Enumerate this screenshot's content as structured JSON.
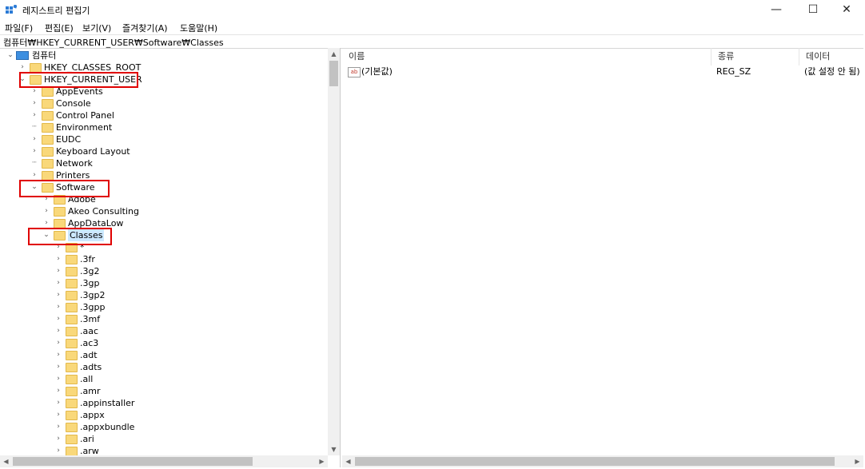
{
  "window": {
    "title": "레지스트리 편집기",
    "controls": {
      "minimize": "—",
      "maximize": "☐",
      "close": "✕"
    }
  },
  "menu": [
    "파일(F)",
    "편집(E)",
    "보기(V)",
    "즐겨찾기(A)",
    "도움말(H)"
  ],
  "address": "컴퓨터₩HKEY_CURRENT_USER₩Software₩Classes",
  "tree": [
    {
      "label": "컴퓨터",
      "level": 0,
      "expanded": true,
      "kind": "computer"
    },
    {
      "label": "HKEY_CLASSES_ROOT",
      "level": 1,
      "expanded": false
    },
    {
      "label": "HKEY_CURRENT_USER",
      "level": 1,
      "expanded": true
    },
    {
      "label": "AppEvents",
      "level": 2,
      "expanded": false
    },
    {
      "label": "Console",
      "level": 2,
      "expanded": false
    },
    {
      "label": "Control Panel",
      "level": 2,
      "expanded": false
    },
    {
      "label": "Environment",
      "level": 2,
      "leaf": true
    },
    {
      "label": "EUDC",
      "level": 2,
      "expanded": false
    },
    {
      "label": "Keyboard Layout",
      "level": 2,
      "expanded": false
    },
    {
      "label": "Network",
      "level": 2,
      "leaf": true
    },
    {
      "label": "Printers",
      "level": 2,
      "expanded": false
    },
    {
      "label": "Software",
      "level": 2,
      "expanded": true
    },
    {
      "label": "Adobe",
      "level": 3,
      "expanded": false
    },
    {
      "label": "Akeo Consulting",
      "level": 3,
      "expanded": false
    },
    {
      "label": "AppDataLow",
      "level": 3,
      "expanded": false
    },
    {
      "label": "Classes",
      "level": 3,
      "expanded": true,
      "selected": true
    },
    {
      "label": "*",
      "level": 4,
      "expanded": false
    },
    {
      "label": ".3fr",
      "level": 4,
      "expanded": false
    },
    {
      "label": ".3g2",
      "level": 4,
      "expanded": false
    },
    {
      "label": ".3gp",
      "level": 4,
      "expanded": false
    },
    {
      "label": ".3gp2",
      "level": 4,
      "expanded": false
    },
    {
      "label": ".3gpp",
      "level": 4,
      "expanded": false
    },
    {
      "label": ".3mf",
      "level": 4,
      "expanded": false
    },
    {
      "label": ".aac",
      "level": 4,
      "expanded": false
    },
    {
      "label": ".ac3",
      "level": 4,
      "expanded": false
    },
    {
      "label": ".adt",
      "level": 4,
      "expanded": false
    },
    {
      "label": ".adts",
      "level": 4,
      "expanded": false
    },
    {
      "label": ".all",
      "level": 4,
      "expanded": false
    },
    {
      "label": ".amr",
      "level": 4,
      "expanded": false
    },
    {
      "label": ".appinstaller",
      "level": 4,
      "expanded": false
    },
    {
      "label": ".appx",
      "level": 4,
      "expanded": false
    },
    {
      "label": ".appxbundle",
      "level": 4,
      "expanded": false
    },
    {
      "label": ".ari",
      "level": 4,
      "expanded": false
    },
    {
      "label": ".arw",
      "level": 4,
      "expanded": false
    }
  ],
  "columns": {
    "name": "이름",
    "type": "종류",
    "data": "데이터"
  },
  "values": [
    {
      "name": "(기본값)",
      "type": "REG_SZ",
      "data": "(값 설정 안 됨)"
    }
  ],
  "icons": {
    "value_string": "ab"
  },
  "highlight_color": "#e00000"
}
